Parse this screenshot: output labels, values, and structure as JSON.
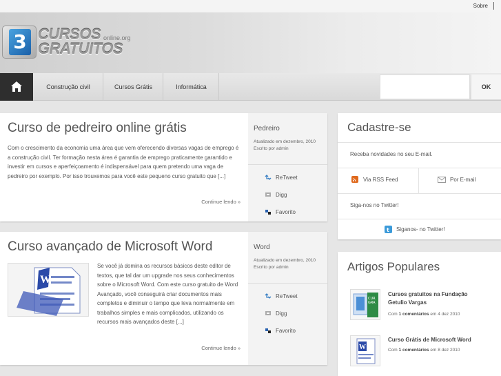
{
  "topbar": {
    "sobre": "Sobre"
  },
  "logo": {
    "line1": "CURSOS",
    "online": "online.org",
    "line2": "GRATUITOS",
    "badge": "3"
  },
  "nav": {
    "items": [
      "Construção civil",
      "Cursos Grátis",
      "Informática"
    ],
    "search_value": "",
    "ok_label": "OK"
  },
  "posts": [
    {
      "title": "Curso de pedreiro online grátis",
      "excerpt": "Com o crescimento da economia uma área que vem oferecendo diversas vagas de emprego é a construção civil. Ter formação nesta área é garantia de emprego praticamente garantido e investir em cursos e aperfeiçoamento é indispensável para quem pretendo uma vaga de pedreiro por exemplo. Por isso trouxemos para você este pequeno curso gratuito que [...]",
      "more": "Continue lendo »",
      "category": "Pedreiro",
      "updated": "Atualizado em dezembro, 2010",
      "author": "Escrito por admin",
      "actions": [
        "ReTweet",
        "Digg",
        "Favorito"
      ]
    },
    {
      "title": "Curso avançado de Microsoft Word",
      "excerpt": "Se você já domina os recursos básicos deste editor de textos, que tal dar um upgrade nos seus conhecimentos sobre o Microsoft Word. Com este curso gratuito de Word Avançado, você conseguirá criar documentos mais completos e diminuir o tempo que leva normalmente em trabalhos simples e mais complicados, utilizando os recursos mais avançados deste [...]",
      "more": "Continue lendo »",
      "category": "Word",
      "updated": "Atualizado em dezembro, 2010",
      "author": "Escrito por admin",
      "actions": [
        "ReTweet",
        "Digg",
        "Favorito"
      ]
    }
  ],
  "cadastre": {
    "title": "Cadastre-se",
    "email_text": "Receba novidades no seu E-mail.",
    "rss": "Via RSS Feed",
    "email": "Por E-mail",
    "twitter_text": "Siga-nos no Twitter!",
    "twitter_link": "Siganos- no Twitter!"
  },
  "popular": {
    "title": "Artigos Populares",
    "items": [
      {
        "title1": "Cursos gratuitos na Fundação",
        "title2": "Getulio Vargas",
        "pre": "Com ",
        "comments": "1 comentários",
        "date": " em 4 dez 2010"
      },
      {
        "title1": "Curso Grátis de Microsoft Word",
        "title2": "",
        "pre": "Com ",
        "comments": "1 comentários",
        "date": " em 8 dez 2010"
      }
    ]
  },
  "colors": {
    "nav_home": "#2e2e2e",
    "rss": "#e06a1e",
    "twitter": "#3b9ad9"
  },
  "icons": [
    "home-icon",
    "retweet-icon",
    "digg-icon",
    "favorite-icon",
    "rss-icon",
    "mail-icon",
    "twitter-icon"
  ]
}
